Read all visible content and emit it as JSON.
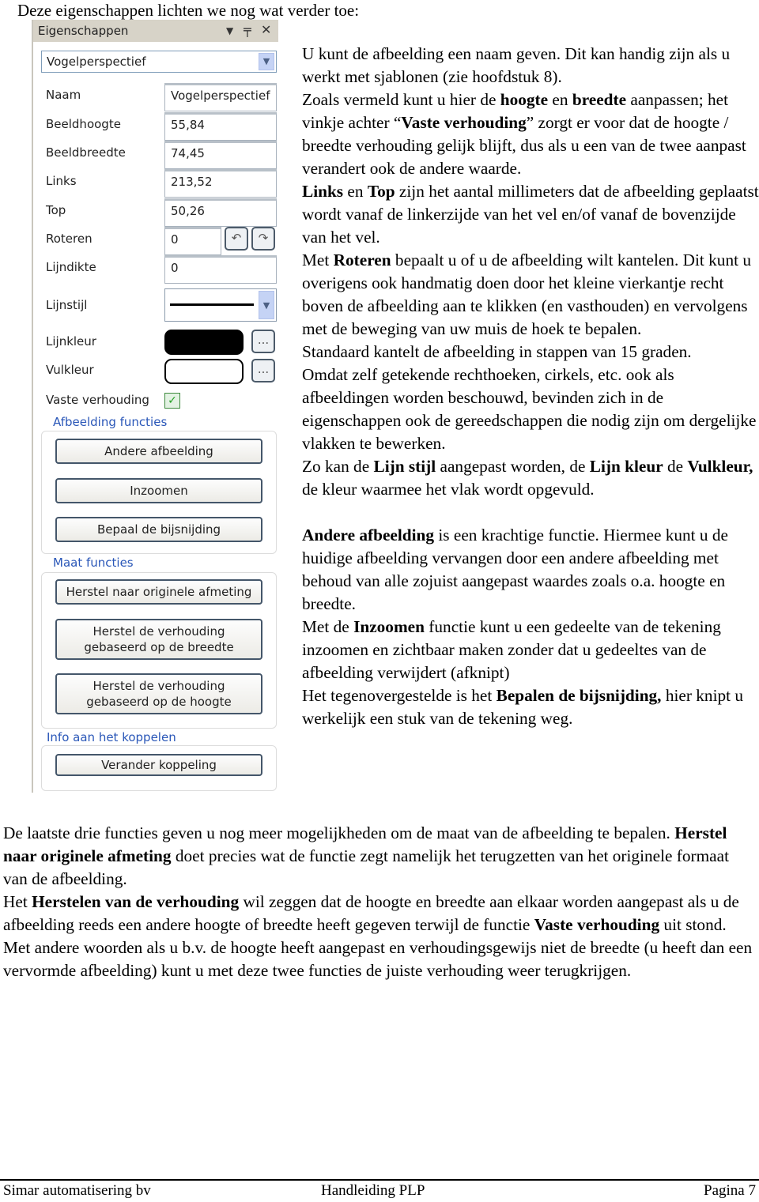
{
  "intro": "Deze eigenschappen lichten we nog wat verder toe:",
  "panel": {
    "title": "Eigenschappen",
    "header_icons": [
      "dropdown-arrow-icon",
      "pin-icon",
      "close-icon"
    ],
    "object_select": "Vogelperspectief",
    "fields": [
      {
        "label": "Naam",
        "value": "Vogelperspectief"
      },
      {
        "label": "Beeldhoogte",
        "value": "55,84"
      },
      {
        "label": "Beeldbreedte",
        "value": "74,45"
      },
      {
        "label": "Links",
        "value": "213,52"
      },
      {
        "label": "Top",
        "value": "50,26"
      },
      {
        "label": "Roteren",
        "value": "0"
      },
      {
        "label": "Lijndikte",
        "value": "0"
      }
    ],
    "lijnstijl_label": "Lijnstijl",
    "lijnkleur_label": "Lijnkleur",
    "lijnkleur_color": "#000000",
    "vulkleur_label": "Vulkleur",
    "vulkleur_color": "#ffffff",
    "ellipsis": "...",
    "vaste_label": "Vaste verhouding",
    "vaste_checked": true,
    "groups": [
      {
        "title": "Afbeelding functies",
        "buttons": [
          "Andere afbeelding",
          "Inzoomen",
          "Bepaal de bijsnijding"
        ]
      },
      {
        "title": "Maat functies",
        "buttons": [
          "Herstel naar originele afmeting",
          "Herstel de verhouding\ngebaseerd op de breedte",
          "Herstel de verhouding\ngebaseerd op de hoogte"
        ]
      },
      {
        "title": "Info aan het koppelen",
        "buttons": [
          "Verander koppeling"
        ]
      }
    ]
  },
  "right_column": [
    [
      {
        "t": "U kunt de afbeelding een naam geven. Dit kan handig zijn als u werkt met sjablonen (zie hoofdstuk 8)."
      }
    ],
    [
      {
        "t": "Zoals vermeld kunt u hier de "
      },
      {
        "t": "hoogte",
        "b": true
      },
      {
        "t": " en "
      },
      {
        "t": "breedte",
        "b": true
      },
      {
        "t": " aanpassen; het vinkje achter “"
      },
      {
        "t": "Vaste verhouding",
        "b": true
      },
      {
        "t": "” zorgt er voor dat de hoogte / breedte verhouding gelijk blijft, dus als u een van de twee aanpast verandert ook de andere waarde."
      }
    ],
    [
      {
        "t": "Links",
        "b": true
      },
      {
        "t": " en "
      },
      {
        "t": "Top",
        "b": true
      },
      {
        "t": " zijn het aantal millimeters dat de afbeelding geplaatst wordt vanaf de linkerzijde van het vel en/of vanaf de bovenzijde van het vel."
      }
    ],
    [
      {
        "t": "Met  "
      },
      {
        "t": "Roteren",
        "b": true
      },
      {
        "t": " bepaalt u of u de afbeelding wilt kantelen. Dit kunt u overigens ook handmatig doen door het kleine vierkantje recht boven de afbeelding aan te klikken (en vasthouden) en vervolgens met de beweging van uw muis de hoek te bepalen."
      }
    ],
    [
      {
        "t": "Standaard kantelt de afbeelding in stappen van 15 graden."
      }
    ],
    [
      {
        "t": "Omdat zelf getekende rechthoeken, cirkels, etc. ook als afbeeldingen worden beschouwd, bevinden zich in de eigenschappen ook de gereedschappen die nodig zijn om dergelijke vlakken te bewerken."
      }
    ],
    [
      {
        "t": "Zo kan de "
      },
      {
        "t": "Lijn stijl",
        "b": true
      },
      {
        "t": " aangepast worden, de "
      },
      {
        "t": "Lijn kleur",
        "b": true
      },
      {
        "t": " de "
      },
      {
        "t": "Vulkleur,",
        "b": true
      },
      {
        "t": " de kleur waarmee het vlak wordt opgevuld."
      }
    ],
    "gap",
    [
      {
        "t": "Andere afbeelding",
        "b": true
      },
      {
        "t": " is een krachtige functie. Hiermee kunt u de huidige afbeelding vervangen door een andere afbeelding met behoud van alle zojuist aangepast waardes zoals o.a. hoogte en breedte."
      }
    ],
    [
      {
        "t": "Met de "
      },
      {
        "t": "Inzoomen",
        "b": true
      },
      {
        "t": " functie kunt u een gedeelte van de tekening inzoomen en zichtbaar maken zonder dat u gedeeltes van de afbeelding verwijdert (afknipt)"
      }
    ],
    [
      {
        "t": "Het tegenovergestelde is het "
      },
      {
        "t": "Bepalen de bijsnijding,",
        "b": true
      },
      {
        "t": " hier knipt u werkelijk een stuk van de tekening weg."
      }
    ]
  ],
  "bottom_text": [
    [
      {
        "t": "De laatste drie functies geven u nog meer mogelijkheden om de maat van de afbeelding te bepalen. "
      },
      {
        "t": "Herstel naar originele afmeting",
        "b": true
      },
      {
        "t": " doet precies wat de functie zegt namelijk het terugzetten van het originele formaat van de afbeelding."
      }
    ],
    [
      {
        "t": "Het "
      },
      {
        "t": "Herstelen van de verhouding",
        "b": true
      },
      {
        "t": " wil zeggen dat de hoogte en breedte aan elkaar worden aangepast als u de afbeelding reeds een andere hoogte of breedte heeft gegeven terwijl de functie "
      },
      {
        "t": "Vaste verhouding",
        "b": true
      },
      {
        "t": " uit stond."
      }
    ],
    [
      {
        "t": "Met andere woorden als u b.v. de hoogte heeft aangepast en verhoudingsgewijs niet de breedte (u heeft dan een vervormde afbeelding) kunt u met deze twee functies de juiste verhouding weer terugkrijgen."
      }
    ]
  ],
  "footer": {
    "left": "Simar automatisering bv",
    "center": "Handleiding PLP",
    "right": "Pagina 7"
  }
}
